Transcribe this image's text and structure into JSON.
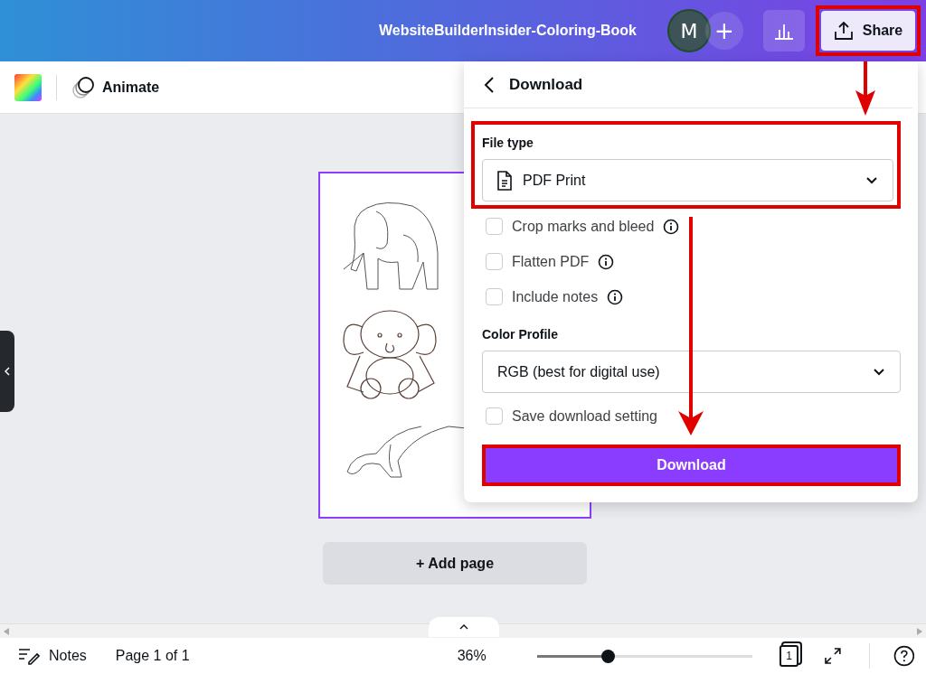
{
  "top_bar": {
    "title": "WebsiteBuilderInsider-Coloring-Book",
    "avatar": "M",
    "add": "+",
    "share": "Share"
  },
  "toolbar": {
    "animate": "Animate"
  },
  "canvas": {
    "add_page": "+ Add page"
  },
  "download_panel": {
    "title": "Download",
    "file_type_label": "File type",
    "file_type": "PDF Print",
    "options": [
      {
        "label": "Crop marks and bleed",
        "checked": false
      },
      {
        "label": "Flatten PDF",
        "checked": false
      },
      {
        "label": "Include notes",
        "checked": false
      }
    ],
    "color_profile_label": "Color Profile",
    "color_profile": "RGB (best for digital use)",
    "save_settings": {
      "label": "Save download setting",
      "checked": false
    },
    "download_button": "Download"
  },
  "footer": {
    "notes": "Notes",
    "page": "Page 1 of 1",
    "zoom": "36%",
    "zoom_slider": {
      "level": 0.33
    },
    "page_count": "1"
  }
}
